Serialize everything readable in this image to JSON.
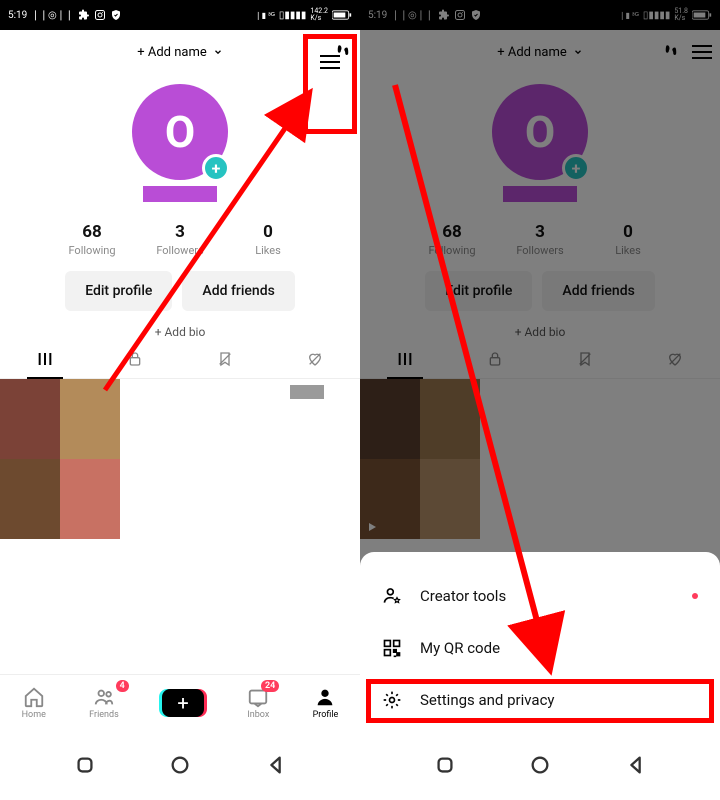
{
  "status": {
    "time": "5:19",
    "net_rate_left": "142.2",
    "net_rate_right": "51.8",
    "net_unit": "K/s"
  },
  "topbar": {
    "add_name": "+ Add name"
  },
  "avatar": {
    "letter": "O",
    "plus": "+"
  },
  "stats": {
    "following": {
      "num": "68",
      "label": "Following"
    },
    "followers": {
      "num": "3",
      "label": "Followers"
    },
    "likes": {
      "num": "0",
      "label": "Likes"
    }
  },
  "actions": {
    "edit": "Edit profile",
    "add_friends": "Add friends",
    "add_bio": "+ Add bio"
  },
  "nav": {
    "home": "Home",
    "friends": "Friends",
    "inbox": "Inbox",
    "profile": "Profile",
    "friends_badge": "4",
    "inbox_badge": "24"
  },
  "sheet": {
    "creator": "Creator tools",
    "qr": "My QR code",
    "settings": "Settings and privacy"
  },
  "mosaic_colors": [
    "#7b4237",
    "#b38b5a",
    "#6d4a2f",
    "#c87163"
  ],
  "mosaic_colors_b": [
    "#5a3f2e",
    "#9e7a50",
    "#7a5235",
    "#b9926a"
  ]
}
